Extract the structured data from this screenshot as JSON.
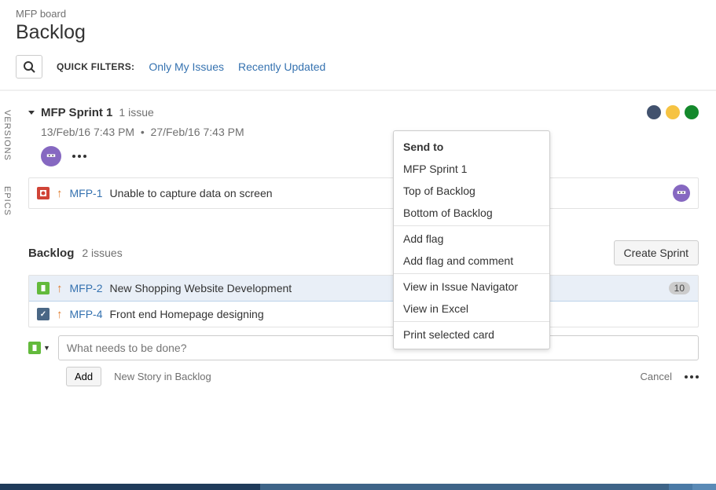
{
  "breadcrumb": "MFP board",
  "page_title": "Backlog",
  "filters": {
    "label": "QUICK FILTERS:",
    "only_my_issues": "Only My Issues",
    "recently_updated": "Recently Updated"
  },
  "side_tabs": {
    "versions": "VERSIONS",
    "epics": "EPICS"
  },
  "sprint": {
    "name": "MFP Sprint 1",
    "issue_count": "1 issue",
    "start_date": "13/Feb/16 7:43 PM",
    "end_date": "27/Feb/16 7:43 PM",
    "status_colors": {
      "todo": "#42526e",
      "inprogress": "#f6c342",
      "done": "#14892c"
    },
    "issues": [
      {
        "key": "MFP-1",
        "summary": "Unable to capture data on screen",
        "type": "bug"
      }
    ]
  },
  "backlog": {
    "title": "Backlog",
    "issue_count": "2 issues",
    "create_sprint": "Create Sprint",
    "issues": [
      {
        "key": "MFP-2",
        "summary": "New Shopping Website Development",
        "type": "story",
        "estimate": "10"
      },
      {
        "key": "MFP-4",
        "summary": "Front end Homepage designing",
        "type": "task"
      }
    ]
  },
  "new_issue": {
    "placeholder": "What needs to be done?",
    "add": "Add",
    "hint": "New Story in Backlog",
    "cancel": "Cancel"
  },
  "context_menu": {
    "title": "Send to",
    "group1": [
      "MFP Sprint 1",
      "Top of Backlog",
      "Bottom of Backlog"
    ],
    "group2": [
      "Add flag",
      "Add flag and comment"
    ],
    "group3": [
      "View in Issue Navigator",
      "View in Excel"
    ],
    "group4": [
      "Print selected card"
    ]
  }
}
